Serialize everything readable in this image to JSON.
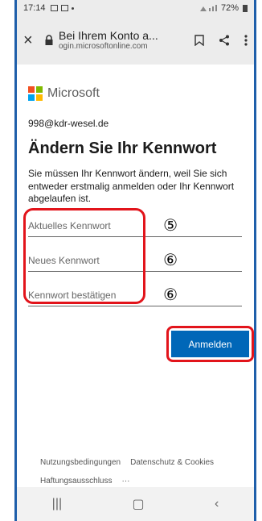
{
  "status": {
    "time": "17:14",
    "battery": "72%"
  },
  "browser": {
    "close": "×",
    "page_title": "Bei Ihrem Konto a...",
    "url": "ogin.microsoftonline.com"
  },
  "brand": {
    "name": "Microsoft",
    "colors": [
      "#f25022",
      "#7fba00",
      "#00a4ef",
      "#ffb900"
    ]
  },
  "account": {
    "email": "998@kdr-wesel.de"
  },
  "form": {
    "title": "Ändern Sie Ihr Kennwort",
    "description": "Sie müssen Ihr Kennwort ändern, weil Sie sich entweder erstmalig anmelden oder Ihr Kennwort abgelaufen ist.",
    "fields": [
      {
        "placeholder": "Aktuelles Kennwort",
        "marker": "⑤"
      },
      {
        "placeholder": "Neues Kennwort",
        "marker": "⑥"
      },
      {
        "placeholder": "Kennwort bestätigen",
        "marker": "⑥"
      }
    ],
    "submit_label": "Anmelden"
  },
  "footer": {
    "terms": "Nutzungsbedingungen",
    "privacy": "Datenschutz & Cookies",
    "disclaimer": "Haftungsausschluss",
    "more": "···"
  },
  "navbar": {
    "recent": "|||",
    "home": "▢",
    "back": "‹"
  },
  "annotation_color": "#e2141b",
  "accent": "#0067b8"
}
